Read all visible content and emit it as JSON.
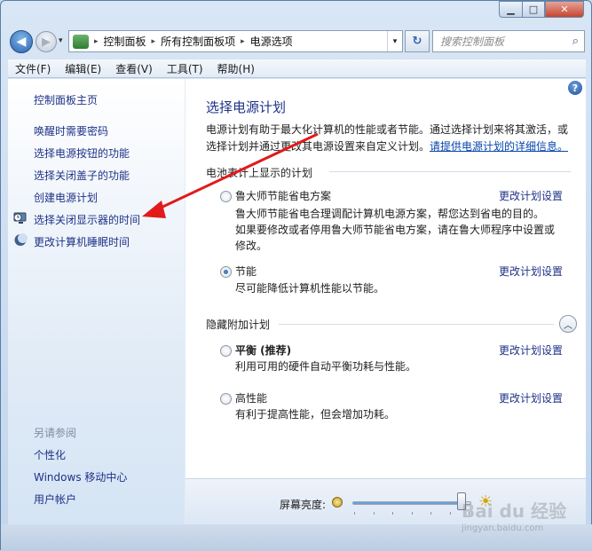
{
  "window": {
    "minimize_glyph": "▁",
    "maximize_glyph": "□",
    "close_glyph": "✕"
  },
  "nav": {
    "back_glyph": "◀",
    "forward_glyph": "▶",
    "dropdown_glyph": "▾",
    "breadcrumbs": [
      "控制面板",
      "所有控制面板项",
      "电源选项"
    ],
    "crumb_separator": "▸",
    "refresh_glyph": "↻",
    "search_placeholder": "搜索控制面板",
    "search_icon": "search-icon"
  },
  "menubar": {
    "items": [
      "文件(F)",
      "编辑(E)",
      "查看(V)",
      "工具(T)",
      "帮助(H)"
    ]
  },
  "sidebar": {
    "home": "控制面板主页",
    "links": [
      "唤醒时需要密码",
      "选择电源按钮的功能",
      "选择关闭盖子的功能",
      "创建电源计划",
      "选择关闭显示器的时间",
      "更改计算机睡眠时间"
    ],
    "see_also": "另请参阅",
    "see_also_links": [
      "个性化",
      "Windows 移动中心",
      "用户帐户"
    ]
  },
  "main": {
    "help_glyph": "?",
    "title": "选择电源计划",
    "intro_1": "电源计划有助于最大化计算机的性能或者节能。通过选择计划来将其激活，或选择计划并通过更改其电源设置来自定义计划。",
    "intro_link": "请提供电源计划的详细信息。",
    "section_battery": "电池表计上显示的计划",
    "section_hidden": "隐藏附加计划",
    "collapse_glyph": "︿",
    "change_label": "更改计划设置",
    "plans": [
      {
        "name": "鲁大师节能省电方案",
        "desc_1": "鲁大师节能省电合理调配计算机电源方案，帮您达到省电的目的。",
        "desc_2": "如果要修改或者停用鲁大师节能省电方案，请在鲁大师程序中设置或修改。",
        "selected": false
      },
      {
        "name": "节能",
        "desc_1": "尽可能降低计算机性能以节能。",
        "selected": true
      },
      {
        "name": "平衡 (推荐)",
        "desc_1": "利用可用的硬件自动平衡功耗与性能。",
        "selected": false
      },
      {
        "name": "高性能",
        "desc_1": "有利于提高性能，但会增加功耗。",
        "selected": false
      }
    ]
  },
  "bottom": {
    "brightness_label": "屏幕亮度:",
    "brightness_level_fraction": 0.92,
    "bright_icon_glyph": "☀"
  },
  "watermark": {
    "text": "Bai du 经验",
    "sub": "jingyan.baidu.com"
  },
  "colors": {
    "link": "#1e3287",
    "arrow": "#e21a1a",
    "accent": "#1c4f97"
  }
}
